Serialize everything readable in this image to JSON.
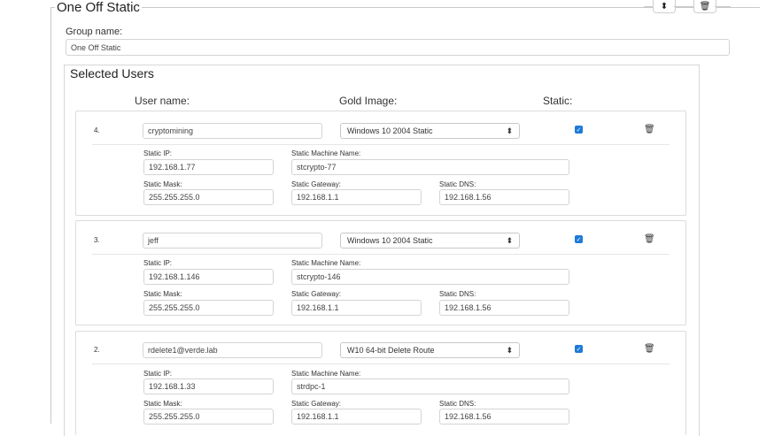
{
  "group": {
    "legend": "One Off Static",
    "sort_icon": "⬍",
    "trash_icon": "🗑",
    "name_label": "Group name:",
    "name_value": "One Off Static"
  },
  "selected_users": {
    "legend": "Selected Users",
    "headers": {
      "user": "User name:",
      "gold": "Gold Image:",
      "static": "Static:"
    },
    "labels": {
      "ip": "Static IP:",
      "machine": "Static Machine Name:",
      "mask": "Static Mask:",
      "gateway": "Static Gateway:",
      "dns": "Static DNS:"
    },
    "select_arrow": "⬍",
    "check_glyph": "✓",
    "trash_glyph": "🗑",
    "users": [
      {
        "index": "4.",
        "username": "cryptomining",
        "gold_image": "Windows 10 2004 Static",
        "ip": "192.168.1.77",
        "machine": "stcrypto-77",
        "mask": "255.255.255.0",
        "gateway": "192.168.1.1",
        "dns": "192.168.1.56"
      },
      {
        "index": "3.",
        "username": "jeff",
        "gold_image": "Windows 10 2004 Static",
        "ip": "192.168.1.146",
        "machine": "stcrypto-146",
        "mask": "255.255.255.0",
        "gateway": "192.168.1.1",
        "dns": "192.168.1.56"
      },
      {
        "index": "2.",
        "username": "rdelete1@verde.lab",
        "gold_image": "W10 64-bit Delete Route",
        "ip": "192.168.1.33",
        "machine": "strdpc-1",
        "mask": "255.255.255.0",
        "gateway": "192.168.1.1",
        "dns": "192.168.1.56"
      }
    ]
  },
  "colors": {
    "checkbox": "#1e7ad8",
    "border": "#d4d4d4"
  }
}
